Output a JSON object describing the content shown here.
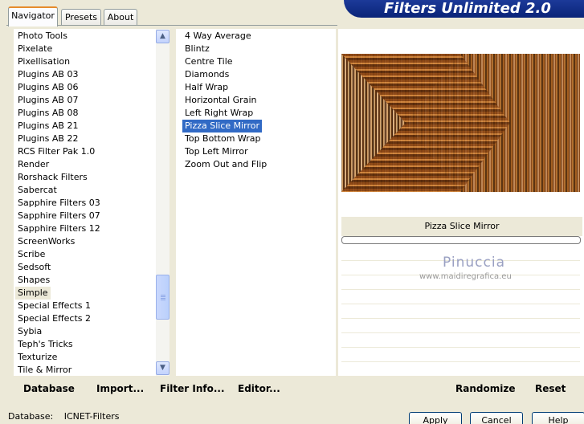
{
  "tabs": [
    "Navigator",
    "Presets",
    "About"
  ],
  "banner": "Filters Unlimited 2.0",
  "categories": [
    "Photo Tools",
    "Pixelate",
    "Pixellisation",
    "Plugins AB 03",
    "Plugins AB 06",
    "Plugins AB 07",
    "Plugins AB 08",
    "Plugins AB 21",
    "Plugins AB 22",
    "RCS Filter Pak 1.0",
    "Render",
    "Rorshack Filters",
    "Sabercat",
    "Sapphire Filters 03",
    "Sapphire Filters 07",
    "Sapphire Filters 12",
    "ScreenWorks",
    "Scribe",
    "Sedsoft",
    "Shapes",
    "Simple",
    "Special Effects 1",
    "Special Effects 2",
    "Sybia",
    "Teph's Tricks",
    "Texturize",
    "Tile & Mirror"
  ],
  "selected_category": "Simple",
  "filters": [
    "4 Way Average",
    "Blintz",
    "Centre Tile",
    "Diamonds",
    "Half Wrap",
    "Horizontal Grain",
    "Left Right Wrap",
    "Pizza Slice Mirror",
    "Top Bottom Wrap",
    "Top Left Mirror",
    "Zoom Out and Flip"
  ],
  "selected_filter": "Pizza Slice Mirror",
  "preview_filter_label": "Pizza Slice Mirror",
  "watermark": {
    "title": "Pinuccia",
    "url": "www.maidiregrafica.eu"
  },
  "bottom_links": {
    "database": "Database",
    "import": "Import...",
    "filter_info": "Filter Info...",
    "editor": "Editor...",
    "randomize": "Randomize",
    "reset": "Reset"
  },
  "status": {
    "label": "Database:",
    "value": "ICNET-Filters"
  },
  "buttons": {
    "apply": "Apply",
    "cancel": "Cancel",
    "help": "Help"
  },
  "icons": {
    "scroll_up": "arrow-up-icon",
    "scroll_down": "arrow-down-icon"
  },
  "colors": {
    "banner_bg": "#0a2478",
    "selection_blue": "#316ac5",
    "panel_bg": "#ece9d8"
  }
}
